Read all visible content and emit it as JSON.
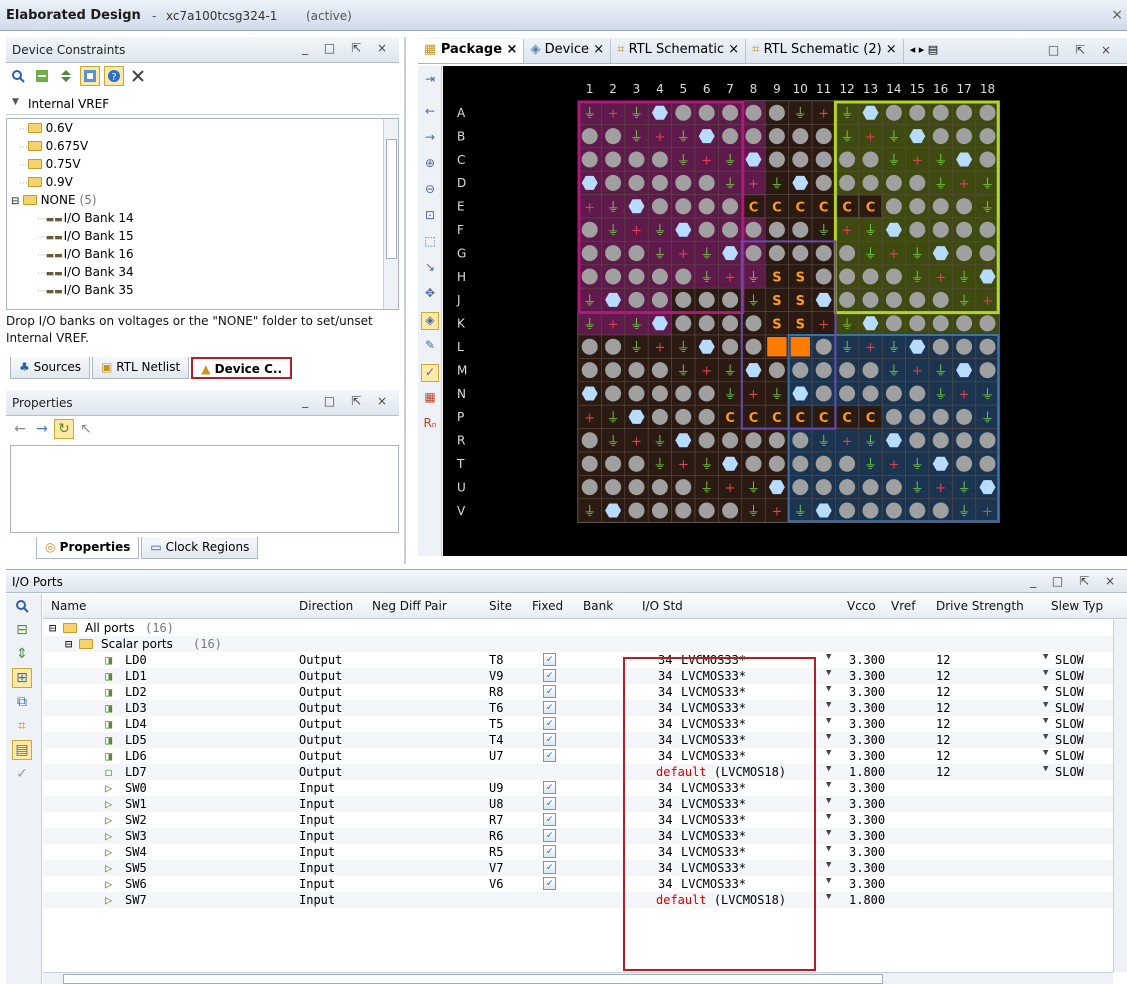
{
  "window": {
    "title": "Elaborated Design",
    "sep": "-",
    "device": "xc7a100tcsg324-1",
    "status": "(active)",
    "close": "×"
  },
  "device_constraints": {
    "title": "Device Constraints",
    "winctl": "_ □ ⇱ ×",
    "section": "Internal VREF",
    "tree": [
      {
        "label": "0.6V",
        "kind": "folder",
        "indent": 1
      },
      {
        "label": "0.675V",
        "kind": "folder",
        "indent": 1
      },
      {
        "label": "0.75V",
        "kind": "folder",
        "indent": 1
      },
      {
        "label": "0.9V",
        "kind": "folder",
        "indent": 1
      },
      {
        "label": "NONE",
        "count": "(5)",
        "kind": "folder-open",
        "indent": 0
      },
      {
        "label": "I/O Bank 14",
        "kind": "bank",
        "indent": 2
      },
      {
        "label": "I/O Bank 15",
        "kind": "bank",
        "indent": 2
      },
      {
        "label": "I/O Bank 16",
        "kind": "bank",
        "indent": 2
      },
      {
        "label": "I/O Bank 34",
        "kind": "bank",
        "indent": 2
      },
      {
        "label": "I/O Bank 35",
        "kind": "bank",
        "indent": 2
      }
    ],
    "hint": "Drop I/O banks on voltages or the \"NONE\" folder to set/unset Internal VREF.",
    "tabs": [
      "Sources",
      "RTL Netlist",
      "Device C.."
    ]
  },
  "properties": {
    "title": "Properties",
    "winctl": "_ □ ⇱ ×",
    "tabs": [
      "Properties",
      "Clock Regions"
    ]
  },
  "package_tabs": [
    "Package",
    "Device",
    "RTL Schematic",
    "RTL Schematic (2)"
  ],
  "package": {
    "cols": [
      "1",
      "2",
      "3",
      "4",
      "5",
      "6",
      "7",
      "8",
      "9",
      "10",
      "11",
      "12",
      "13",
      "14",
      "15",
      "16",
      "17",
      "18"
    ],
    "rows": [
      "A",
      "B",
      "C",
      "D",
      "E",
      "F",
      "G",
      "H",
      "J",
      "K",
      "L",
      "M",
      "N",
      "P",
      "R",
      "T",
      "U",
      "V"
    ],
    "c_row_e": [
      "C",
      "C",
      "C",
      "C",
      "C",
      "C"
    ],
    "c_row_p": [
      "C",
      "C",
      "C",
      "C",
      "C",
      "C",
      "C"
    ],
    "s_label": "S"
  },
  "io_ports": {
    "title": "I/O Ports",
    "winctl": "_ □ ⇱ ×",
    "columns": [
      "Name",
      "Direction",
      "Neg Diff Pair",
      "Site",
      "Fixed",
      "Bank",
      "I/O Std",
      "Vcco",
      "Vref",
      "Drive Strength",
      "Slew Typ"
    ],
    "all_ports": "All ports",
    "all_count": "(16)",
    "scalar_ports": "Scalar ports",
    "scalar_count": "(16)",
    "rows": [
      {
        "name": "LD0",
        "dir": "Output",
        "site": "T8",
        "fixed": true,
        "bank": "34",
        "std": "LVCMOS33*",
        "vcco": "3.300",
        "drive": "12",
        "slew": "SLOW"
      },
      {
        "name": "LD1",
        "dir": "Output",
        "site": "V9",
        "fixed": true,
        "bank": "34",
        "std": "LVCMOS33*",
        "vcco": "3.300",
        "drive": "12",
        "slew": "SLOW"
      },
      {
        "name": "LD2",
        "dir": "Output",
        "site": "R8",
        "fixed": true,
        "bank": "34",
        "std": "LVCMOS33*",
        "vcco": "3.300",
        "drive": "12",
        "slew": "SLOW"
      },
      {
        "name": "LD3",
        "dir": "Output",
        "site": "T6",
        "fixed": true,
        "bank": "34",
        "std": "LVCMOS33*",
        "vcco": "3.300",
        "drive": "12",
        "slew": "SLOW"
      },
      {
        "name": "LD4",
        "dir": "Output",
        "site": "T5",
        "fixed": true,
        "bank": "34",
        "std": "LVCMOS33*",
        "vcco": "3.300",
        "drive": "12",
        "slew": "SLOW"
      },
      {
        "name": "LD5",
        "dir": "Output",
        "site": "T4",
        "fixed": true,
        "bank": "34",
        "std": "LVCMOS33*",
        "vcco": "3.300",
        "drive": "12",
        "slew": "SLOW"
      },
      {
        "name": "LD6",
        "dir": "Output",
        "site": "U7",
        "fixed": true,
        "bank": "34",
        "std": "LVCMOS33*",
        "vcco": "3.300",
        "drive": "12",
        "slew": "SLOW"
      },
      {
        "name": "LD7",
        "dir": "Output",
        "site": "",
        "fixed": false,
        "bank": "",
        "std": "default",
        "std2": "(LVCMOS18)",
        "vcco": "1.800",
        "drive": "12",
        "slew": "SLOW"
      },
      {
        "name": "SW0",
        "dir": "Input",
        "site": "U9",
        "fixed": true,
        "bank": "34",
        "std": "LVCMOS33*",
        "vcco": "3.300",
        "drive": "",
        "slew": ""
      },
      {
        "name": "SW1",
        "dir": "Input",
        "site": "U8",
        "fixed": true,
        "bank": "34",
        "std": "LVCMOS33*",
        "vcco": "3.300",
        "drive": "",
        "slew": ""
      },
      {
        "name": "SW2",
        "dir": "Input",
        "site": "R7",
        "fixed": true,
        "bank": "34",
        "std": "LVCMOS33*",
        "vcco": "3.300",
        "drive": "",
        "slew": ""
      },
      {
        "name": "SW3",
        "dir": "Input",
        "site": "R6",
        "fixed": true,
        "bank": "34",
        "std": "LVCMOS33*",
        "vcco": "3.300",
        "drive": "",
        "slew": ""
      },
      {
        "name": "SW4",
        "dir": "Input",
        "site": "R5",
        "fixed": true,
        "bank": "34",
        "std": "LVCMOS33*",
        "vcco": "3.300",
        "drive": "",
        "slew": ""
      },
      {
        "name": "SW5",
        "dir": "Input",
        "site": "V7",
        "fixed": true,
        "bank": "34",
        "std": "LVCMOS33*",
        "vcco": "3.300",
        "drive": "",
        "slew": ""
      },
      {
        "name": "SW6",
        "dir": "Input",
        "site": "V6",
        "fixed": true,
        "bank": "34",
        "std": "LVCMOS33*",
        "vcco": "3.300",
        "drive": "",
        "slew": ""
      },
      {
        "name": "SW7",
        "dir": "Input",
        "site": "",
        "fixed": false,
        "bank": "",
        "std": "default",
        "std2": "(LVCMOS18)",
        "vcco": "1.800",
        "drive": "",
        "slew": ""
      }
    ]
  },
  "colors": {
    "highlight_box": "#b02028",
    "warning_text": "#d00000",
    "bank_purple": "#b0187a",
    "bank_green": "#b4d42a",
    "bank_blue": "#3a72a8"
  }
}
